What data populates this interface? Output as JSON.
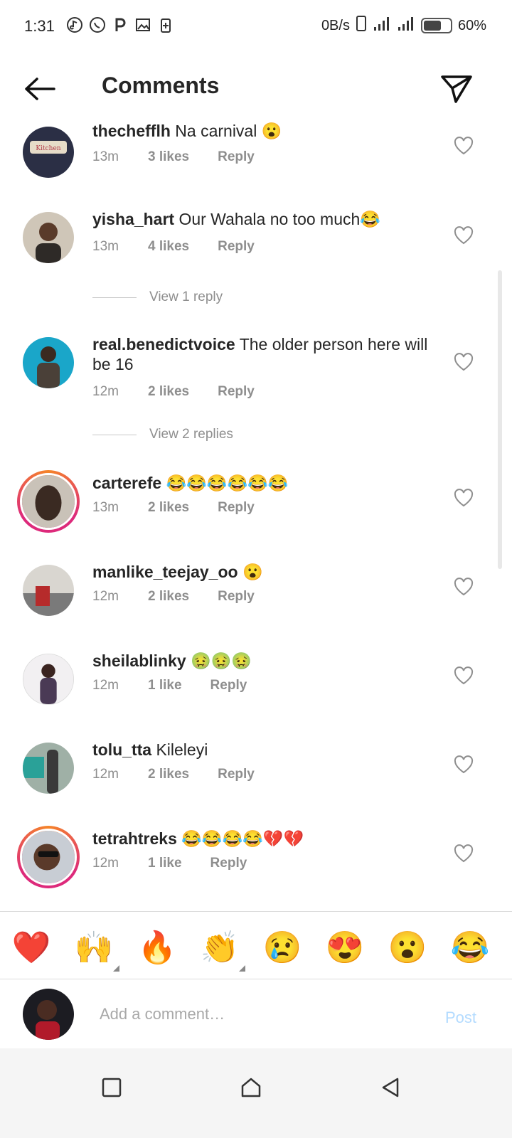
{
  "status_bar": {
    "time": "1:31",
    "net_speed": "0B/s",
    "battery": "60%"
  },
  "header": {
    "title": "Comments"
  },
  "comments": [
    {
      "username": "thechefflh",
      "text": "Na carnival 😮",
      "time": "13m",
      "likes": "3 likes",
      "reply": "Reply"
    },
    {
      "username": "yisha_hart",
      "text": "Our Wahala no too much😂",
      "time": "13m",
      "likes": "4 likes",
      "reply": "Reply"
    },
    {
      "username": "real.benedictvoice",
      "text": "The older person here will be 16",
      "time": "12m",
      "likes": "2 likes",
      "reply": "Reply"
    },
    {
      "username": "carterefe",
      "text": "😂😂😂😂😂😂",
      "time": "13m",
      "likes": "2 likes",
      "reply": "Reply"
    },
    {
      "username": "manlike_teejay_oo",
      "text": "😮",
      "time": "12m",
      "likes": "2 likes",
      "reply": "Reply"
    },
    {
      "username": "sheilablinky",
      "text": "🤢🤢🤢",
      "time": "12m",
      "likes": "1 like",
      "reply": "Reply"
    },
    {
      "username": "tolu_tta",
      "text": "Kileleyi",
      "time": "12m",
      "likes": "2 likes",
      "reply": "Reply"
    },
    {
      "username": "tetrahtreks",
      "text": "😂😂😂😂💔💔",
      "time": "12m",
      "likes": "1 like",
      "reply": "Reply"
    }
  ],
  "view_replies": [
    "View 1 reply",
    "View 2 replies"
  ],
  "reactions": [
    "❤️",
    "🙌",
    "🔥",
    "👏",
    "😢",
    "😍",
    "😮",
    "😂"
  ],
  "composer": {
    "placeholder": "Add a comment…",
    "post_label": "Post"
  },
  "icons": {
    "back": "arrow-left-icon",
    "send": "paper-plane-icon",
    "heart": "heart-outline-icon",
    "nav_recent": "square-icon",
    "nav_home": "home-icon",
    "nav_back": "triangle-back-icon"
  },
  "colors": {
    "text": "#262626",
    "secondary": "#8e8e8e",
    "post_disabled": "#b3dbff",
    "story_ring": "#dd2a7b"
  }
}
